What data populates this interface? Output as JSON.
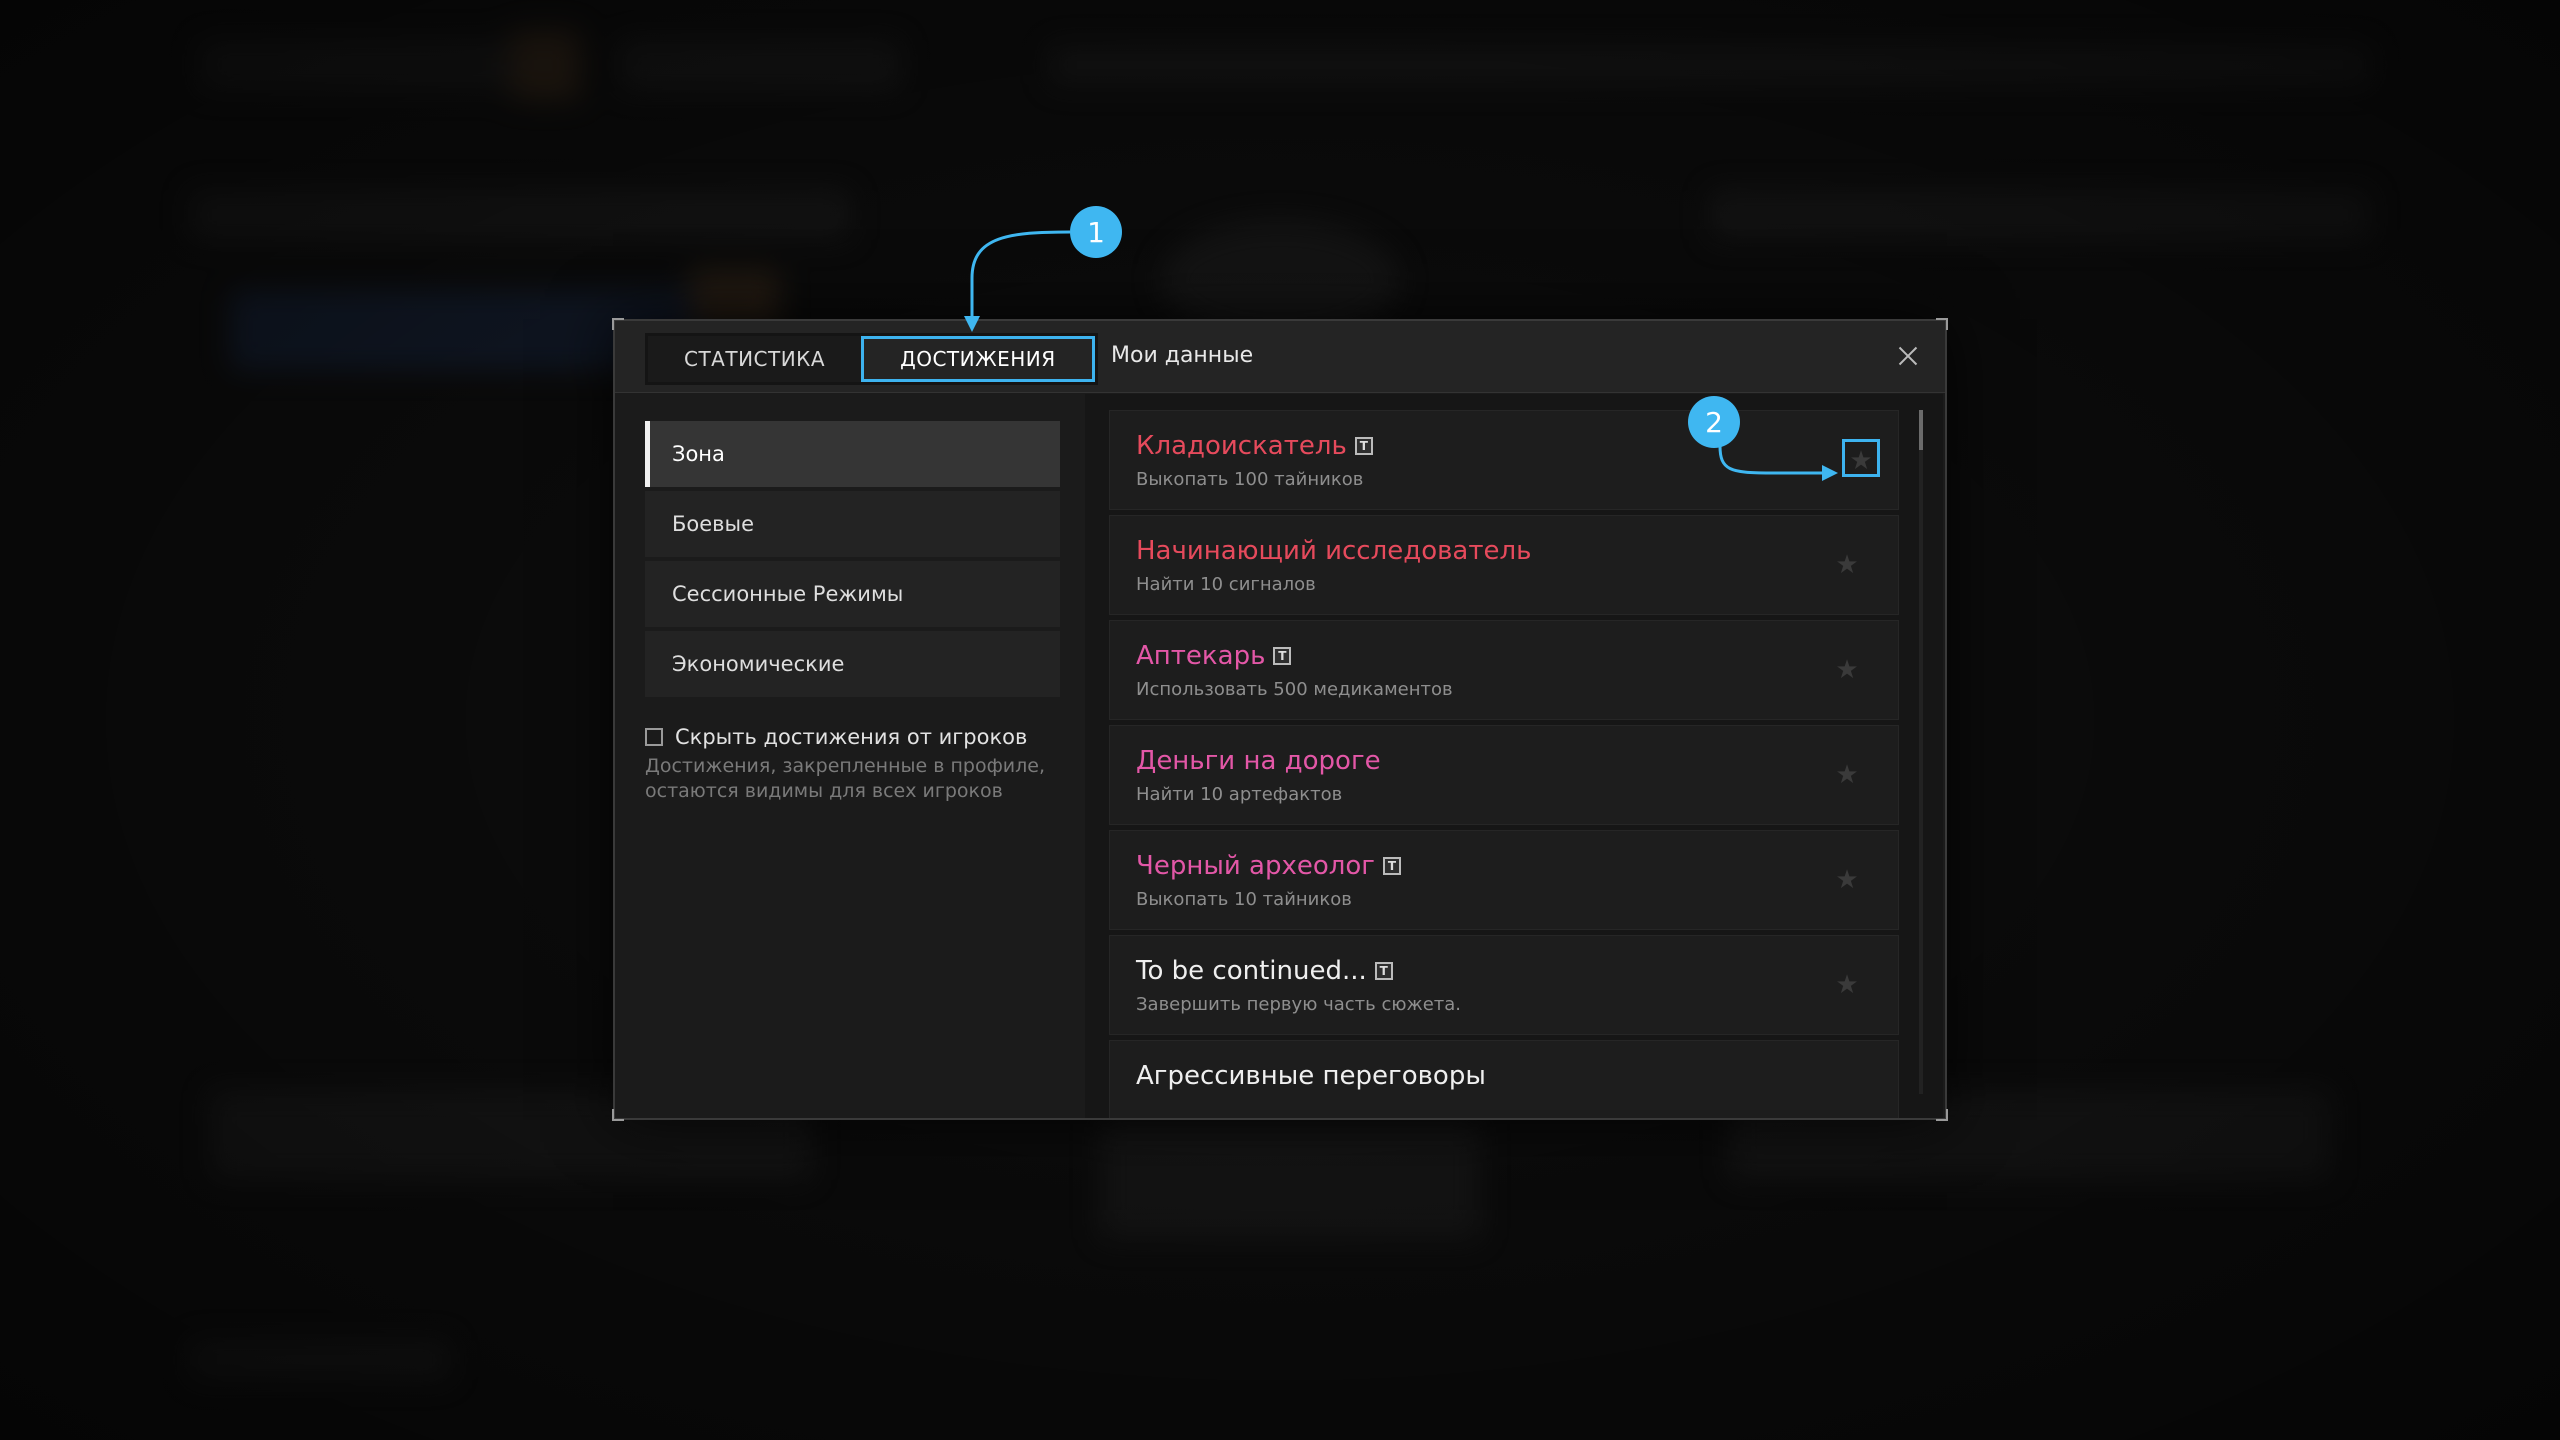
{
  "modal": {
    "title": "Мои данные",
    "tabs": [
      {
        "label": "СТАТИСТИКА",
        "active": false
      },
      {
        "label": "ДОСТИЖЕНИЯ",
        "active": true
      }
    ]
  },
  "categories": [
    {
      "label": "Зона",
      "active": true
    },
    {
      "label": "Боевые",
      "active": false
    },
    {
      "label": "Сессионные Режимы",
      "active": false
    },
    {
      "label": "Экономические",
      "active": false
    }
  ],
  "hide": {
    "label": "Скрыть достижения от игроков",
    "description": "Достижения, закрепленные в профиле, остаются видимы для всех игроков"
  },
  "achievements": [
    {
      "title": "Кладоискатель",
      "desc": "Выкопать 100 тайников",
      "color": "#e64a5c",
      "badge": "T"
    },
    {
      "title": "Начинающий исследователь",
      "desc": "Найти 10 сигналов",
      "color": "#e64a5c",
      "badge": ""
    },
    {
      "title": "Аптекарь",
      "desc": "Использовать 500 медикаментов",
      "color": "#e357a7",
      "badge": "T"
    },
    {
      "title": "Деньги на дороге",
      "desc": "Найти 10 артефактов",
      "color": "#e357a7",
      "badge": ""
    },
    {
      "title": "Черный археолог",
      "desc": "Выкопать 10 тайников",
      "color": "#e357a7",
      "badge": "T"
    },
    {
      "title": "To be continued...",
      "desc": "Завершить первую часть сюжета.",
      "color": "#efefef",
      "badge": "T"
    },
    {
      "title": "Агрессивные переговоры",
      "desc": "",
      "color": "#efefef",
      "badge": ""
    }
  ],
  "callouts": [
    "1",
    "2"
  ],
  "accent_color": "#3db3ef"
}
